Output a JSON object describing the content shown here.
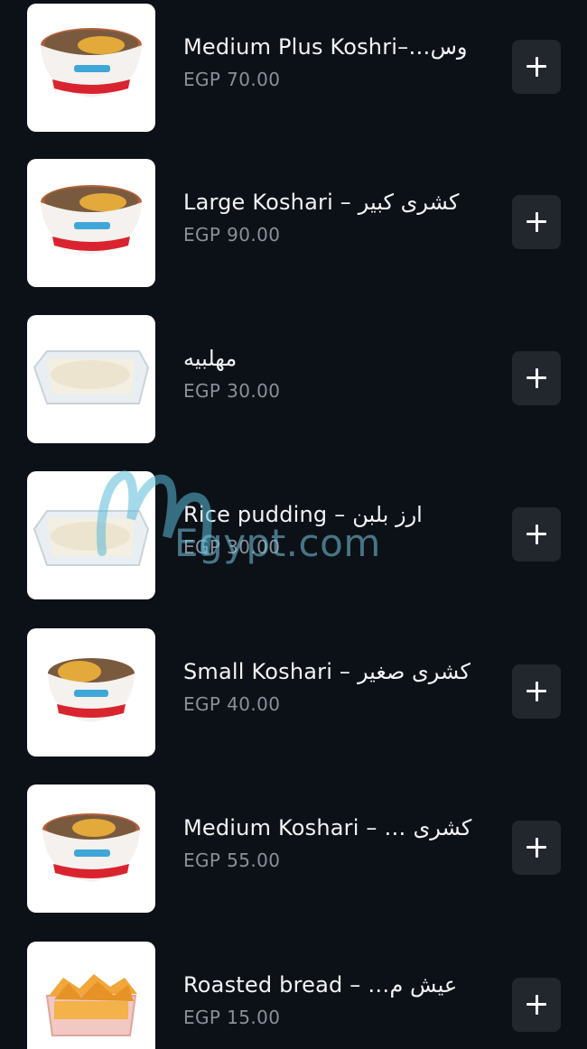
{
  "menu": {
    "items": [
      {
        "name": "Medium Plus Koshri–…وس",
        "price": "EGP 70.00",
        "image": "koshari-bowl"
      },
      {
        "name": "Large Koshari – كشرى كبير",
        "price": "EGP 90.00",
        "image": "koshari-bowl"
      },
      {
        "name": "مهلبيه",
        "price": "EGP 30.00",
        "image": "pudding-tray"
      },
      {
        "name": "Rice pudding – ارز بلبن",
        "price": "EGP 30.00",
        "image": "pudding-tray"
      },
      {
        "name": "Small Koshari – كشرى صغير",
        "price": "EGP 40.00",
        "image": "koshari-bowl"
      },
      {
        "name": "Medium Koshari – … كشرى",
        "price": "EGP 55.00",
        "image": "koshari-bowl"
      },
      {
        "name": "Roasted bread – …عيش م",
        "price": "EGP 15.00",
        "image": "bread-box"
      }
    ],
    "add_button_icon": "plus-icon"
  },
  "watermark": {
    "text": "MenuEgypt.com",
    "visible_text": "Egypt.com"
  },
  "colors": {
    "background": "#0c1117",
    "button": "#22272e",
    "name_text": "#f2f3f5",
    "price_text": "#8a9099"
  }
}
